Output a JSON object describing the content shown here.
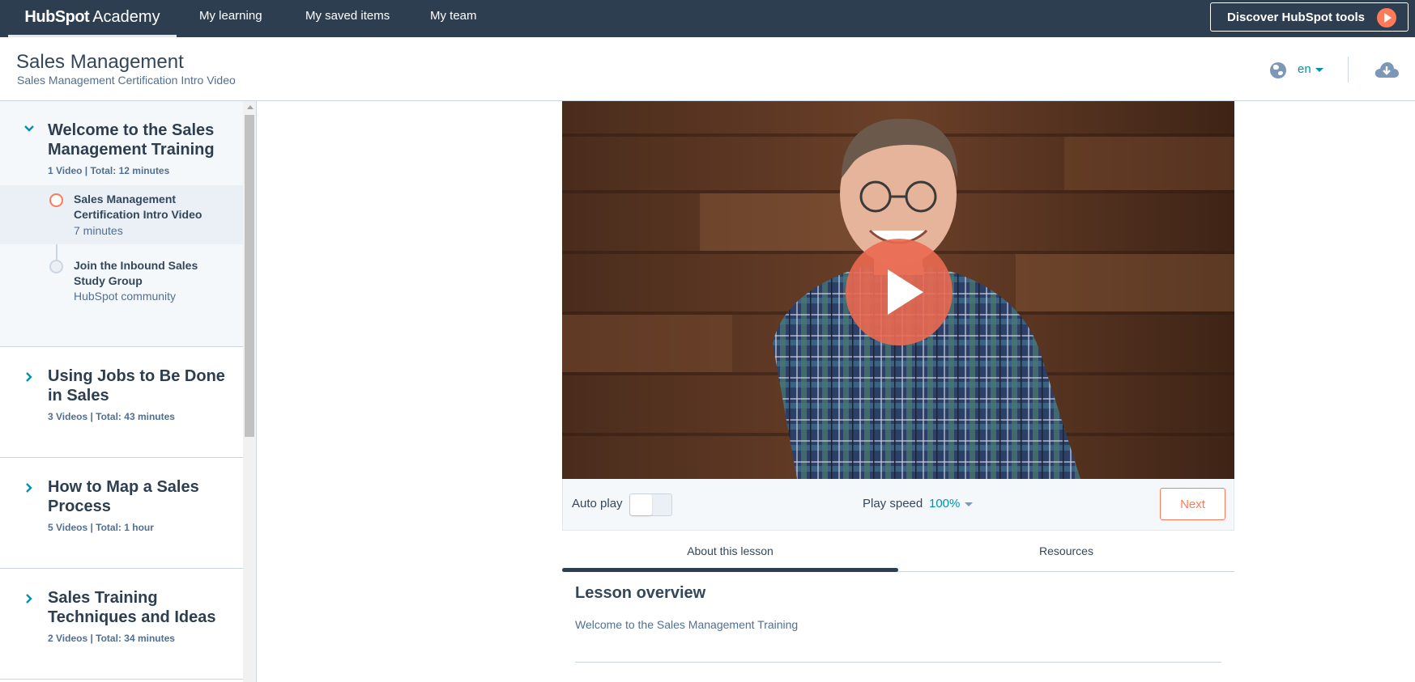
{
  "topnav": {
    "logo_brand": "HubSpot",
    "logo_sub": "Academy",
    "items": [
      "My learning",
      "My saved items",
      "My team"
    ],
    "discover_label": "Discover HubSpot tools"
  },
  "header": {
    "course_title": "Sales Management",
    "course_subtitle": "Sales Management Certification Intro Video",
    "language": "en",
    "icons": [
      "globe-icon",
      "cloud-download-icon"
    ]
  },
  "sidebar": {
    "sections": [
      {
        "title": "Welcome to the Sales Management Training",
        "meta": "1 Video | Total: 12 minutes",
        "expanded": true,
        "lessons": [
          {
            "title": "Sales Management Certification Intro Video",
            "meta": "7 minutes",
            "active": true
          },
          {
            "title": "Join the Inbound Sales Study Group",
            "meta": "HubSpot community",
            "active": false
          }
        ]
      },
      {
        "title": "Using Jobs to Be Done in Sales",
        "meta": "3 Videos | Total: 43 minutes",
        "expanded": false
      },
      {
        "title": "How to Map a Sales Process",
        "meta": "5 Videos | Total: 1 hour",
        "expanded": false
      },
      {
        "title": "Sales Training Techniques and Ideas",
        "meta": "2 Videos | Total: 34 minutes",
        "expanded": false
      }
    ]
  },
  "player": {
    "autoplay_label": "Auto play",
    "autoplay_on": false,
    "speed_label": "Play speed",
    "speed_value": "100%",
    "next_label": "Next"
  },
  "tabs": {
    "about": "About this lesson",
    "resources": "Resources",
    "active": "about"
  },
  "lesson": {
    "overview_title": "Lesson overview",
    "overview_text": "Welcome to the Sales Management Training"
  },
  "colors": {
    "nav_bg": "#2d3e50",
    "accent_orange": "#ff7a59",
    "link_teal": "#0091ae",
    "text_dark": "#33475b"
  }
}
